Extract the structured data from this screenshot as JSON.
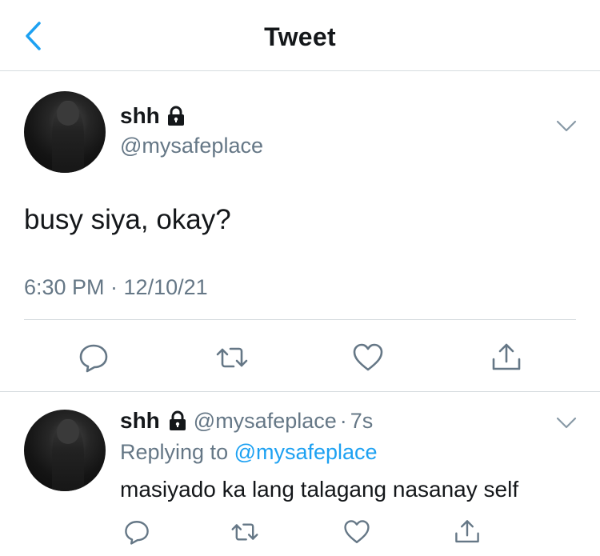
{
  "header": {
    "title": "Tweet",
    "back_icon": "chevron-left-icon"
  },
  "colors": {
    "accent": "#1da1f2",
    "text_primary": "#14171a",
    "text_secondary": "#657786",
    "divider": "#d6dbdf"
  },
  "main_tweet": {
    "name": "shh",
    "protected_icon": "lock-icon",
    "handle": "@mysafeplace",
    "text": "busy siya, okay?",
    "timestamp": "6:30 PM · 12/10/21",
    "actions": [
      "reply-icon",
      "retweet-icon",
      "like-icon",
      "share-icon"
    ]
  },
  "reply_tweet": {
    "name": "shh",
    "handle": "@mysafeplace",
    "separator": "·",
    "time": "7s",
    "replying_prefix": "Replying to ",
    "replying_to": "@mysafeplace",
    "text": "masiyado ka lang talagang nasanay self",
    "actions": [
      "reply-icon",
      "retweet-icon",
      "like-icon",
      "share-icon"
    ]
  }
}
